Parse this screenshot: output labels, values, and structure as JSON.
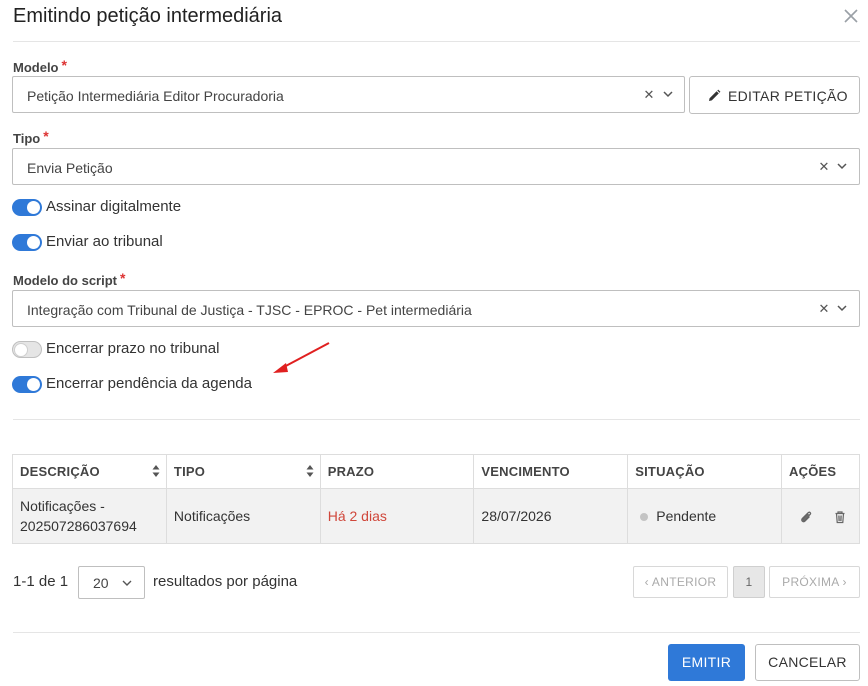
{
  "dialog": {
    "title": "Emitindo petição intermediária"
  },
  "modelo": {
    "label": "Modelo",
    "required": "*",
    "value": "Petição Intermediária Editor Procuradoria",
    "edit_button": "EDITAR PETIÇÃO"
  },
  "tipo": {
    "label": "Tipo",
    "required": "*",
    "value": "Envia Petição"
  },
  "toggles": [
    {
      "label": "Assinar digitalmente",
      "on": true
    },
    {
      "label": "Enviar ao tribunal",
      "on": true
    }
  ],
  "script": {
    "label": "Modelo do script",
    "required": "*",
    "value": "Integração com Tribunal de Justiça - TJSC - EPROC - Pet intermediária"
  },
  "toggles2": [
    {
      "label": "Encerrar prazo no tribunal",
      "on": false
    },
    {
      "label": "Encerrar pendência da agenda",
      "on": true
    }
  ],
  "table": {
    "headers": [
      "DESCRIÇÃO",
      "TIPO",
      "PRAZO",
      "VENCIMENTO",
      "SITUAÇÃO",
      "AÇÕES"
    ],
    "rows": [
      {
        "descricao_line1": "Notificações -",
        "descricao_line2": "202507286037694",
        "tipo": "Notificações",
        "prazo": "Há 2 dias",
        "vencimento": "28/07/2026",
        "situacao": "Pendente"
      }
    ]
  },
  "pagination": {
    "range": "1-1 de 1",
    "per_page": "20",
    "per_page_label": "resultados por página",
    "prev": "‹ ANTERIOR",
    "current": "1",
    "next": "PRÓXIMA ›"
  },
  "footer": {
    "emit": "EMITIR",
    "cancel": "CANCELAR"
  },
  "colors": {
    "primary": "#2f79d8",
    "required": "#dd3333",
    "overdue": "#d0473b",
    "annotation_arrow": "#e02020"
  },
  "icons": [
    "close-icon",
    "clear-icon",
    "chevron-down-icon",
    "pencil-icon",
    "sort-icon",
    "paperclip-icon",
    "trash-icon",
    "arrow-annotation"
  ]
}
